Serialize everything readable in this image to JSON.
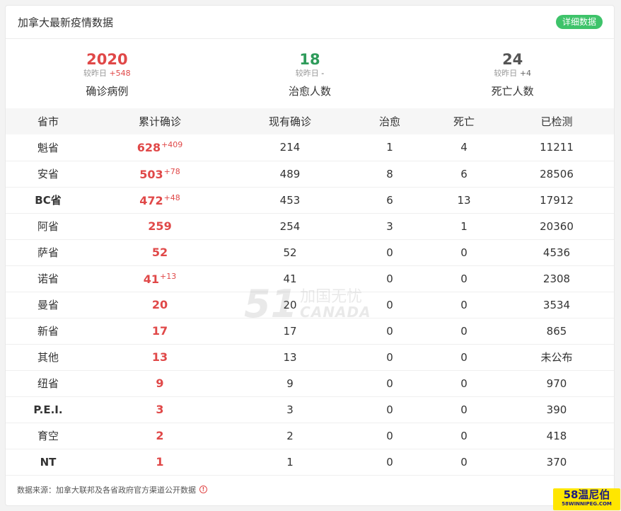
{
  "header": {
    "title": "加拿大最新疫情数据",
    "detail_button": "详细数据"
  },
  "summary": [
    {
      "value": "2020",
      "delta_label": "较昨日",
      "delta": "+548",
      "label": "确诊病例",
      "color": "#e04848"
    },
    {
      "value": "18",
      "delta_label": "较昨日",
      "delta": "-",
      "label": "治愈人数",
      "color": "#2e9b5a"
    },
    {
      "value": "24",
      "delta_label": "较昨日",
      "delta": "+4",
      "label": "死亡人数",
      "color": "#555555"
    }
  ],
  "table": {
    "columns": [
      "省市",
      "累计确诊",
      "现有确诊",
      "治愈",
      "死亡",
      "已检测"
    ],
    "rows": [
      {
        "province": "魁省",
        "total": "628",
        "new": "+409",
        "active": "214",
        "recovered": "1",
        "deaths": "4",
        "tested": "11211"
      },
      {
        "province": "安省",
        "total": "503",
        "new": "+78",
        "active": "489",
        "recovered": "8",
        "deaths": "6",
        "tested": "28506"
      },
      {
        "province": "BC省",
        "total": "472",
        "new": "+48",
        "active": "453",
        "recovered": "6",
        "deaths": "13",
        "tested": "17912"
      },
      {
        "province": "阿省",
        "total": "259",
        "new": "",
        "active": "254",
        "recovered": "3",
        "deaths": "1",
        "tested": "20360"
      },
      {
        "province": "萨省",
        "total": "52",
        "new": "",
        "active": "52",
        "recovered": "0",
        "deaths": "0",
        "tested": "4536"
      },
      {
        "province": "诺省",
        "total": "41",
        "new": "+13",
        "active": "41",
        "recovered": "0",
        "deaths": "0",
        "tested": "2308"
      },
      {
        "province": "曼省",
        "total": "20",
        "new": "",
        "active": "20",
        "recovered": "0",
        "deaths": "0",
        "tested": "3534"
      },
      {
        "province": "新省",
        "total": "17",
        "new": "",
        "active": "17",
        "recovered": "0",
        "deaths": "0",
        "tested": "865"
      },
      {
        "province": "其他",
        "total": "13",
        "new": "",
        "active": "13",
        "recovered": "0",
        "deaths": "0",
        "tested": "未公布"
      },
      {
        "province": "纽省",
        "total": "9",
        "new": "",
        "active": "9",
        "recovered": "0",
        "deaths": "0",
        "tested": "970"
      },
      {
        "province": "P.E.I.",
        "total": "3",
        "new": "",
        "active": "3",
        "recovered": "0",
        "deaths": "0",
        "tested": "390"
      },
      {
        "province": "育空",
        "total": "2",
        "new": "",
        "active": "2",
        "recovered": "0",
        "deaths": "0",
        "tested": "418"
      },
      {
        "province": "NT",
        "total": "1",
        "new": "",
        "active": "1",
        "recovered": "0",
        "deaths": "0",
        "tested": "370"
      }
    ]
  },
  "footer": {
    "source": "数据来源：加拿大联邦及各省政府官方渠道公开数据",
    "info_icon": "info-icon"
  },
  "watermark": {
    "number": "51",
    "cn": "加国无忧",
    "en": "CANADA"
  },
  "logo": {
    "line1": "58温尼伯",
    "line2": "58WINNIPEG.COM"
  }
}
